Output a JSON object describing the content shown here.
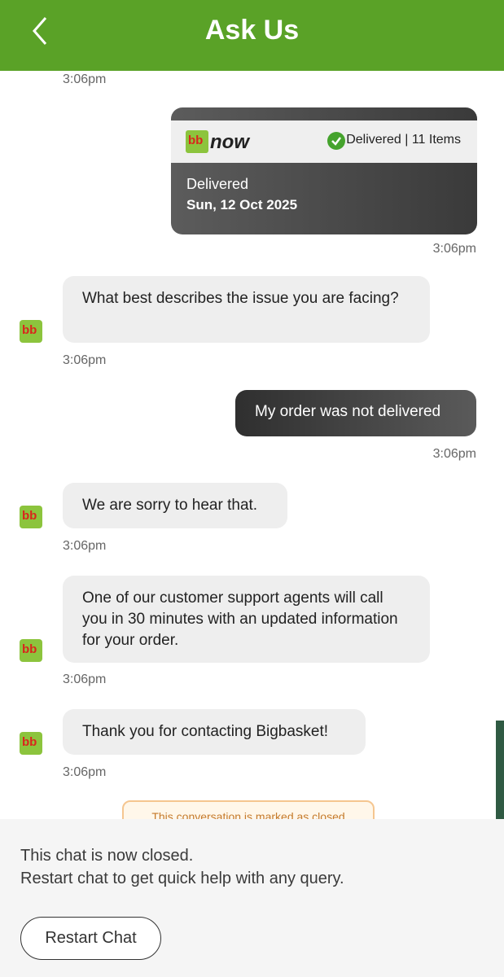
{
  "header": {
    "title": "Ask Us",
    "back_icon": "chevron-left-icon"
  },
  "order_card": {
    "logo_text": "bb",
    "logo_suffix": "now",
    "status": "Delivered | 11 Items",
    "delivery_label": "Delivered",
    "date": "Sun, 12 Oct 2025"
  },
  "messages": {
    "ts_top": "3:06pm",
    "ts_card": "3:06pm",
    "q1": "What best describes the issue you are facing?",
    "ts_q1": "3:06pm",
    "user_reply": "My order was not delivered",
    "ts_user": "3:06pm",
    "sorry": "We are sorry to hear that.",
    "ts_sorry": "3:06pm",
    "agents": "One of our customer support agents will call you in 30 minutes with an updated information for your order.",
    "ts_agents": "3:06pm",
    "thanks": "Thank you for contacting Bigbasket!",
    "ts_thanks": "3:06pm",
    "closed_note": "This conversation is marked as closed"
  },
  "footer": {
    "line1": "This chat is now closed.",
    "line2": "Restart chat to get quick help with any query.",
    "restart_label": "Restart Chat"
  },
  "avatar": {
    "letters": "bb"
  },
  "colors": {
    "brand_green": "#5aa227",
    "logo_green": "#8cc43d",
    "logo_red": "#d9261c"
  }
}
